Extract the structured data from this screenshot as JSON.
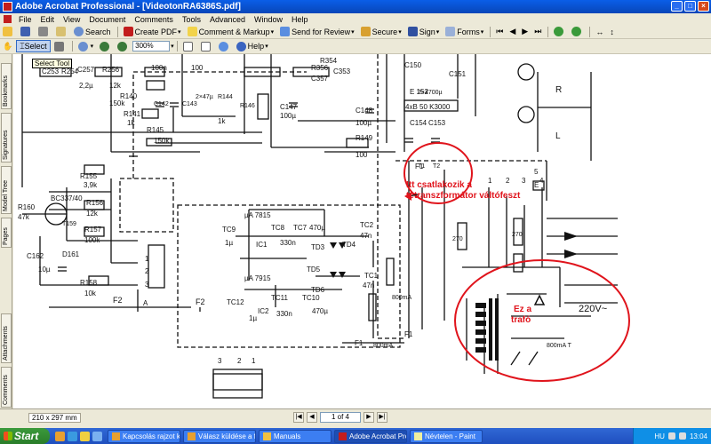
{
  "window": {
    "title": "Adobe Acrobat Professional - [VideotonRA6386S.pdf]"
  },
  "menu": [
    "File",
    "Edit",
    "View",
    "Document",
    "Comments",
    "Tools",
    "Advanced",
    "Window",
    "Help"
  ],
  "toolbar1": {
    "search": "Search",
    "create_pdf": "Create PDF",
    "comment_markup": "Comment & Markup",
    "send_review": "Send for Review",
    "secure": "Secure",
    "sign": "Sign",
    "forms": "Forms"
  },
  "toolbar2": {
    "select": "Select",
    "zoom_value": "300%",
    "help": "Help"
  },
  "tooltip": "Select Tool",
  "nav_tabs": [
    "Bookmarks",
    "Signatures",
    "Model Tree",
    "Pages",
    "Attachments",
    "Comments"
  ],
  "schematic": {
    "labels": [
      "C253",
      "R254",
      "C257",
      "R256",
      "2,2µ",
      "12k",
      "R140",
      "150k",
      "R141",
      "1k",
      "C142",
      "C143",
      "R144",
      "R146",
      "100n",
      "100",
      "2×47µ",
      "1k",
      "C147",
      "100µ",
      "R145",
      "150k",
      "R356",
      "C357",
      "C353",
      "R354",
      "C148",
      "100µ",
      "R149",
      "100",
      "C150",
      "C151",
      "E 152",
      "4xB 50 K3000",
      "C154",
      "C153",
      "2×4700µ",
      "R155",
      "3,9k",
      "BC337/40",
      "R160",
      "47k",
      "T159",
      "R156",
      "12k",
      "R157",
      "100k",
      "D161",
      "C162",
      "10µ",
      "R158",
      "10k",
      "F2",
      "F2",
      "A",
      "1",
      "2",
      "3",
      "µA 7815",
      "TC9",
      "TC8",
      "TC7",
      "470µ",
      "IC1",
      "330n",
      "1µ",
      "TD3",
      "TD4",
      "TC2",
      "47n",
      "µA 7915",
      "TD5",
      "TD6",
      "TC1",
      "47n",
      "TC12",
      "TC11",
      "TC10",
      "330n",
      "470µ",
      "IC2",
      "1µ",
      "800mA",
      "800mA",
      "F1",
      "F1",
      "270",
      "270",
      "E",
      "1",
      "2",
      "3",
      "4",
      "5",
      "R",
      "L",
      "220V~",
      "800mA T",
      "3",
      "2",
      "1",
      "T1",
      "T2",
      "F1"
    ],
    "annotations": {
      "connector_note": "Itt csatlakozik a tetranszformátor váltófeszt",
      "trafo_note": "Ez a trafó"
    }
  },
  "status": {
    "page_size": "210 x 297 mm",
    "page_indicator": "1 of 4"
  },
  "taskbar": {
    "start": "Start",
    "items": [
      "Kapcsolás rajzot kere...",
      "Válasz küldése a fóru...",
      "Manuals",
      "Adobe Acrobat Profe...",
      "Névtelen - Paint"
    ],
    "language": "HU",
    "clock": "13:04"
  },
  "colors": {
    "title_bar": "#0a5ee8",
    "taskbar": "#3168d5",
    "annotation_red": "#e0141c",
    "start_green": "#3c9a3c"
  },
  "icons": {
    "print": "printer-icon",
    "save": "save-icon",
    "email": "email-icon",
    "search": "search-icon",
    "hand": "hand-icon",
    "zoom_in": "zoom-in-icon",
    "zoom_out": "zoom-out-icon",
    "help": "help-icon"
  }
}
